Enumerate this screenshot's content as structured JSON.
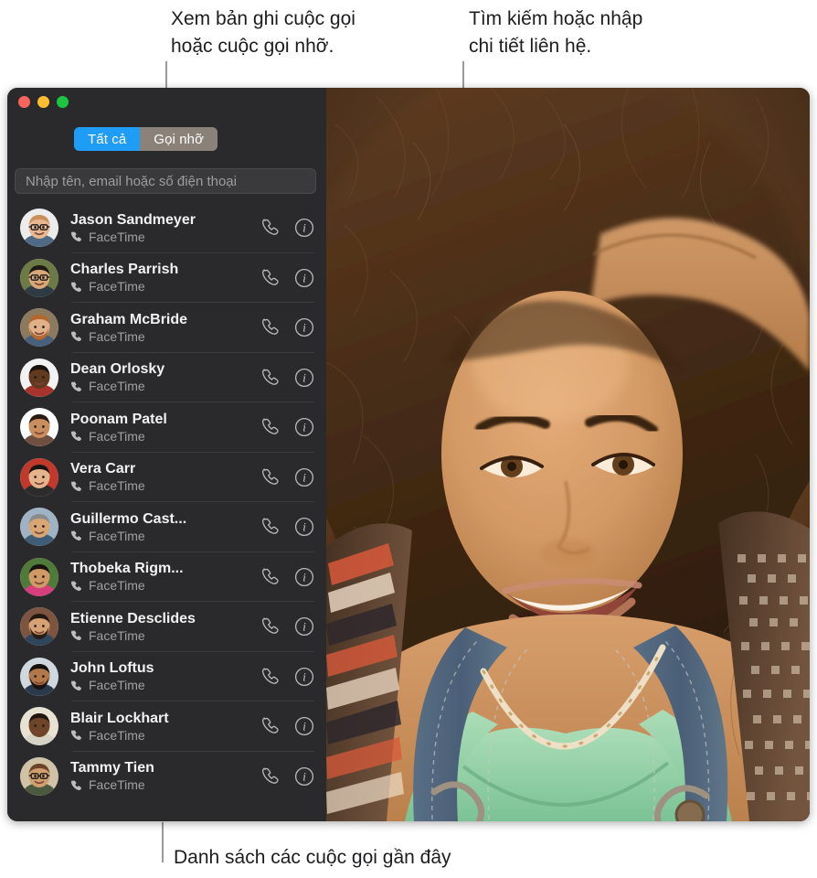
{
  "annotations": {
    "recents_callout": "Xem bản ghi cuộc gọi\nhoặc cuộc gọi nhỡ.",
    "search_callout": "Tìm kiếm hoặc nhập\nchi tiết liên hệ.",
    "list_callout": "Danh sách các cuộc gọi gần đây"
  },
  "window": {
    "traffic_lights": {
      "close_color": "#f9655b",
      "minimize_color": "#fdbd2e",
      "zoom_color": "#1cc642"
    },
    "accent_color": "#1f9cf5"
  },
  "sidebar": {
    "segmented_control": {
      "selected_index": 0,
      "options": [
        {
          "label": "Tất cả",
          "selected": true
        },
        {
          "label": "Gọi nhỡ",
          "selected": false
        }
      ]
    },
    "search": {
      "value": "",
      "placeholder": "Nhập tên, email hoặc số điện thoại"
    },
    "contacts": [
      {
        "name": "Jason Sandmeyer",
        "service": "FaceTime"
      },
      {
        "name": "Charles Parrish",
        "service": "FaceTime"
      },
      {
        "name": "Graham McBride",
        "service": "FaceTime"
      },
      {
        "name": "Dean Orlosky",
        "service": "FaceTime"
      },
      {
        "name": "Poonam Patel",
        "service": "FaceTime"
      },
      {
        "name": "Vera Carr",
        "service": "FaceTime"
      },
      {
        "name": "Guillermo Cast...",
        "service": "FaceTime"
      },
      {
        "name": "Thobeka Rigm...",
        "service": "FaceTime"
      },
      {
        "name": "Etienne Desclides",
        "service": "FaceTime"
      },
      {
        "name": "John Loftus",
        "service": "FaceTime"
      },
      {
        "name": "Blair Lockhart",
        "service": "FaceTime"
      },
      {
        "name": "Tammy Tien",
        "service": "FaceTime"
      }
    ]
  },
  "video": {
    "description": "Video cuộc gọi FaceTime"
  }
}
